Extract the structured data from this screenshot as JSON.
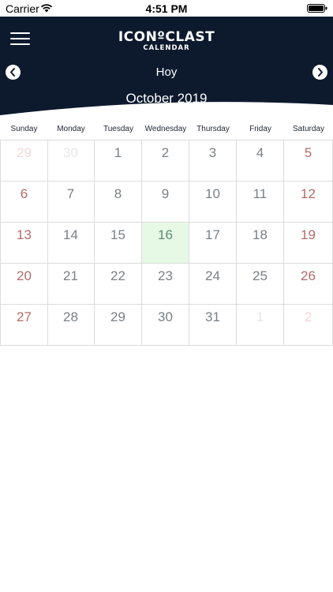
{
  "status_bar": {
    "carrier": "Carrier",
    "time": "4:51 PM"
  },
  "header": {
    "logo_main": "ICONºCLAST",
    "logo_sub": "CALENDAR",
    "today_label": "Hoy",
    "month_title": "October 2019",
    "icons": {
      "menu": "hamburger-menu-icon",
      "prev": "chevron-left-icon",
      "next": "chevron-right-icon"
    }
  },
  "colors": {
    "header_bg": "#0d1a2e",
    "weekday_number": "#7a8087",
    "weekend_number": "#b36a6a",
    "other_month_number": "#e7e7e9",
    "today_cell_bg": "#e6f9e5",
    "grid_line": "#dcdcdc"
  },
  "weekdays": [
    "Sunday",
    "Monday",
    "Tuesday",
    "Wednesday",
    "Thursday",
    "Friday",
    "Saturday"
  ],
  "weeks": [
    [
      {
        "d": "29",
        "m": "prev"
      },
      {
        "d": "30",
        "m": "prev"
      },
      {
        "d": "1"
      },
      {
        "d": "2"
      },
      {
        "d": "3"
      },
      {
        "d": "4"
      },
      {
        "d": "5"
      }
    ],
    [
      {
        "d": "6"
      },
      {
        "d": "7"
      },
      {
        "d": "8"
      },
      {
        "d": "9"
      },
      {
        "d": "10"
      },
      {
        "d": "11"
      },
      {
        "d": "12"
      }
    ],
    [
      {
        "d": "13"
      },
      {
        "d": "14"
      },
      {
        "d": "15"
      },
      {
        "d": "16",
        "today": true
      },
      {
        "d": "17"
      },
      {
        "d": "18"
      },
      {
        "d": "19"
      }
    ],
    [
      {
        "d": "20"
      },
      {
        "d": "21"
      },
      {
        "d": "22"
      },
      {
        "d": "23"
      },
      {
        "d": "24"
      },
      {
        "d": "25"
      },
      {
        "d": "26"
      }
    ],
    [
      {
        "d": "27"
      },
      {
        "d": "28"
      },
      {
        "d": "29"
      },
      {
        "d": "30"
      },
      {
        "d": "31"
      },
      {
        "d": "1",
        "m": "next"
      },
      {
        "d": "2",
        "m": "next"
      }
    ]
  ]
}
